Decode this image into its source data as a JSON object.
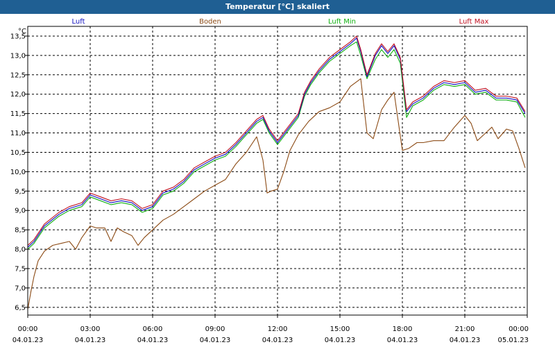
{
  "window": {
    "title": "Temperatur [°C] skaliert"
  },
  "chart_data": {
    "type": "line",
    "title": "Temperatur [°C] skaliert",
    "ylabel": "°C",
    "ylim": [
      6.3,
      13.75
    ],
    "yticks": [
      6.5,
      7.0,
      7.5,
      8.0,
      8.5,
      9.0,
      9.5,
      10.0,
      10.5,
      11.0,
      11.5,
      12.0,
      12.5,
      13.0,
      13.5
    ],
    "ytick_labels": [
      "6,5",
      "7,0",
      "7,5",
      "8,0",
      "8,5",
      "9,0",
      "9,5",
      "10,0",
      "10,5",
      "11,0",
      "11,5",
      "12,0",
      "12,5",
      "13,0",
      "13,5"
    ],
    "xlim": [
      0,
      24
    ],
    "xticks": [
      0,
      3,
      6,
      9,
      12,
      15,
      18,
      21,
      24
    ],
    "xtick_times": [
      "00:00",
      "03:00",
      "06:00",
      "09:00",
      "12:00",
      "15:00",
      "18:00",
      "21:00",
      "00:00"
    ],
    "xtick_dates": [
      "04.01.23",
      "04.01.23",
      "04.01.23",
      "04.01.23",
      "04.01.23",
      "04.01.23",
      "04.01.23",
      "04.01.23",
      "05.01.23"
    ],
    "grid": true,
    "legend_position": "top",
    "series": [
      {
        "name": "Luft",
        "color": "#1010c0",
        "x": [
          0,
          0.3,
          0.8,
          1.5,
          2,
          2.6,
          3,
          3.5,
          4,
          4.5,
          5,
          5.5,
          6,
          6.5,
          7,
          7.5,
          8,
          8.5,
          9,
          9.5,
          10,
          10.5,
          11,
          11.3,
          11.6,
          12,
          12.5,
          13,
          13.3,
          13.6,
          14,
          14.5,
          15,
          15.5,
          15.8,
          16,
          16.3,
          16.7,
          17,
          17.3,
          17.6,
          17.9,
          18.2,
          18.5,
          19,
          19.5,
          20,
          20.5,
          21,
          21.5,
          22,
          22.5,
          23,
          23.5,
          23.9
        ],
        "y": [
          8.05,
          8.2,
          8.6,
          8.9,
          9.05,
          9.15,
          9.4,
          9.3,
          9.2,
          9.25,
          9.2,
          9.0,
          9.1,
          9.45,
          9.55,
          9.75,
          10.05,
          10.2,
          10.35,
          10.45,
          10.7,
          11.0,
          11.3,
          11.4,
          11.05,
          10.75,
          11.1,
          11.45,
          12.0,
          12.3,
          12.6,
          12.9,
          13.1,
          13.3,
          13.45,
          13.1,
          12.45,
          13.0,
          13.25,
          13.05,
          13.25,
          12.9,
          11.55,
          11.75,
          11.9,
          12.15,
          12.3,
          12.25,
          12.3,
          12.05,
          12.1,
          11.9,
          11.9,
          11.85,
          11.5
        ]
      },
      {
        "name": "Boden",
        "color": "#8b4a14",
        "x": [
          0,
          0.15,
          0.3,
          0.5,
          0.8,
          1.2,
          1.6,
          2,
          2.3,
          2.6,
          3,
          3.3,
          3.7,
          4,
          4.3,
          4.6,
          5,
          5.3,
          5.6,
          6,
          6.5,
          7,
          7.5,
          8,
          8.5,
          9,
          9.5,
          10,
          10.5,
          11,
          11.3,
          11.5,
          11.7,
          12,
          12.3,
          12.6,
          13,
          13.5,
          14,
          14.5,
          15,
          15.5,
          16,
          16.3,
          16.6,
          17,
          17.3,
          17.6,
          18,
          18.3,
          18.7,
          19,
          19.5,
          20,
          20.5,
          21,
          21.3,
          21.6,
          22,
          22.3,
          22.6,
          23,
          23.3,
          23.6,
          23.9
        ],
        "y": [
          6.45,
          6.9,
          7.3,
          7.7,
          7.95,
          8.1,
          8.15,
          8.2,
          8.0,
          8.3,
          8.6,
          8.55,
          8.55,
          8.2,
          8.55,
          8.45,
          8.35,
          8.1,
          8.3,
          8.5,
          8.75,
          8.9,
          9.1,
          9.3,
          9.5,
          9.65,
          9.8,
          10.2,
          10.5,
          10.9,
          10.3,
          9.45,
          9.5,
          9.55,
          10.0,
          10.55,
          10.95,
          11.3,
          11.55,
          11.65,
          11.8,
          12.2,
          12.4,
          11.0,
          10.85,
          11.6,
          11.85,
          12.05,
          10.55,
          10.6,
          10.75,
          10.75,
          10.8,
          10.8,
          11.15,
          11.45,
          11.25,
          10.8,
          11.0,
          11.15,
          10.85,
          11.1,
          11.05,
          10.6,
          10.1
        ]
      },
      {
        "name": "Luft Min",
        "color": "#10b010",
        "x": [
          0,
          0.3,
          0.8,
          1.5,
          2,
          2.6,
          3,
          3.5,
          4,
          4.5,
          5,
          5.5,
          6,
          6.5,
          7,
          7.5,
          8,
          8.5,
          9,
          9.5,
          10,
          10.5,
          11,
          11.3,
          11.6,
          12,
          12.5,
          13,
          13.3,
          13.6,
          14,
          14.5,
          15,
          15.5,
          15.8,
          16,
          16.3,
          16.7,
          17,
          17.3,
          17.6,
          17.9,
          18.2,
          18.5,
          19,
          19.5,
          20,
          20.5,
          21,
          21.5,
          22,
          22.5,
          23,
          23.5,
          23.9
        ],
        "y": [
          8.0,
          8.15,
          8.55,
          8.85,
          9.0,
          9.1,
          9.35,
          9.25,
          9.15,
          9.2,
          9.15,
          8.95,
          9.05,
          9.4,
          9.5,
          9.7,
          10.0,
          10.15,
          10.3,
          10.4,
          10.65,
          10.95,
          11.25,
          11.35,
          11.0,
          10.7,
          11.05,
          11.4,
          11.95,
          12.25,
          12.55,
          12.85,
          13.05,
          13.25,
          13.35,
          13.0,
          12.4,
          12.9,
          13.15,
          12.95,
          13.15,
          12.8,
          11.4,
          11.7,
          11.85,
          12.1,
          12.25,
          12.2,
          12.25,
          12.0,
          12.05,
          11.85,
          11.85,
          11.8,
          11.4
        ]
      },
      {
        "name": "Luft Max",
        "color": "#c01020",
        "x": [
          0,
          0.3,
          0.8,
          1.5,
          2,
          2.6,
          3,
          3.5,
          4,
          4.5,
          5,
          5.5,
          6,
          6.5,
          7,
          7.5,
          8,
          8.5,
          9,
          9.5,
          10,
          10.5,
          11,
          11.3,
          11.6,
          12,
          12.5,
          13,
          13.3,
          13.6,
          14,
          14.5,
          15,
          15.5,
          15.8,
          16,
          16.3,
          16.7,
          17,
          17.3,
          17.6,
          17.9,
          18.2,
          18.5,
          19,
          19.5,
          20,
          20.5,
          21,
          21.5,
          22,
          22.5,
          23,
          23.5,
          23.9
        ],
        "y": [
          8.1,
          8.25,
          8.65,
          8.95,
          9.1,
          9.2,
          9.45,
          9.35,
          9.25,
          9.3,
          9.25,
          9.05,
          9.15,
          9.5,
          9.6,
          9.8,
          10.1,
          10.25,
          10.4,
          10.5,
          10.75,
          11.05,
          11.35,
          11.45,
          11.1,
          10.8,
          11.15,
          11.5,
          12.05,
          12.35,
          12.65,
          12.95,
          13.15,
          13.35,
          13.5,
          13.15,
          12.5,
          13.05,
          13.3,
          13.1,
          13.3,
          12.95,
          11.6,
          11.8,
          11.95,
          12.2,
          12.35,
          12.3,
          12.35,
          12.1,
          12.15,
          11.95,
          11.95,
          11.9,
          11.55
        ]
      }
    ]
  }
}
